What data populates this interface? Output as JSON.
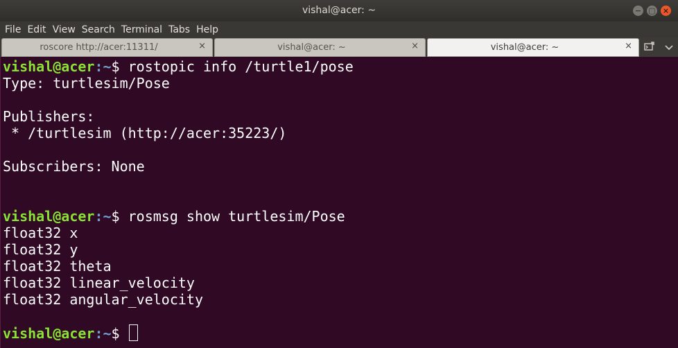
{
  "window": {
    "title": "vishal@acer: ~",
    "buttons": [
      "−",
      "▢",
      "×"
    ]
  },
  "menubar": {
    "items": [
      "File",
      "Edit",
      "View",
      "Search",
      "Terminal",
      "Tabs",
      "Help"
    ]
  },
  "tabs": [
    {
      "label": "roscore http://acer:11311/",
      "close": "×",
      "active": false
    },
    {
      "label": "vishal@acer: ~",
      "close": "×",
      "active": false
    },
    {
      "label": "vishal@acer: ~",
      "close": "×",
      "active": true
    }
  ],
  "tab_tools": {
    "new_tab_icon": "new-tab-icon",
    "menu_icon": "chevron-down-icon"
  },
  "terminal": {
    "prompt_user": "vishal@acer",
    "prompt_path": ":~",
    "prompt_symbol": "$ ",
    "lines": [
      {
        "type": "prompt",
        "command": "rostopic info /turtle1/pose"
      },
      {
        "type": "output",
        "text": "Type: turtlesim/Pose"
      },
      {
        "type": "output",
        "text": ""
      },
      {
        "type": "output",
        "text": "Publishers:"
      },
      {
        "type": "output",
        "text": " * /turtlesim (http://acer:35223/)"
      },
      {
        "type": "output",
        "text": ""
      },
      {
        "type": "output",
        "text": "Subscribers: None"
      },
      {
        "type": "output",
        "text": ""
      },
      {
        "type": "output",
        "text": ""
      },
      {
        "type": "prompt",
        "command": "rosmsg show turtlesim/Pose"
      },
      {
        "type": "output",
        "text": "float32 x"
      },
      {
        "type": "output",
        "text": "float32 y"
      },
      {
        "type": "output",
        "text": "float32 theta"
      },
      {
        "type": "output",
        "text": "float32 linear_velocity"
      },
      {
        "type": "output",
        "text": "float32 angular_velocity"
      },
      {
        "type": "output",
        "text": ""
      },
      {
        "type": "prompt",
        "command": "",
        "cursor": true
      }
    ]
  }
}
